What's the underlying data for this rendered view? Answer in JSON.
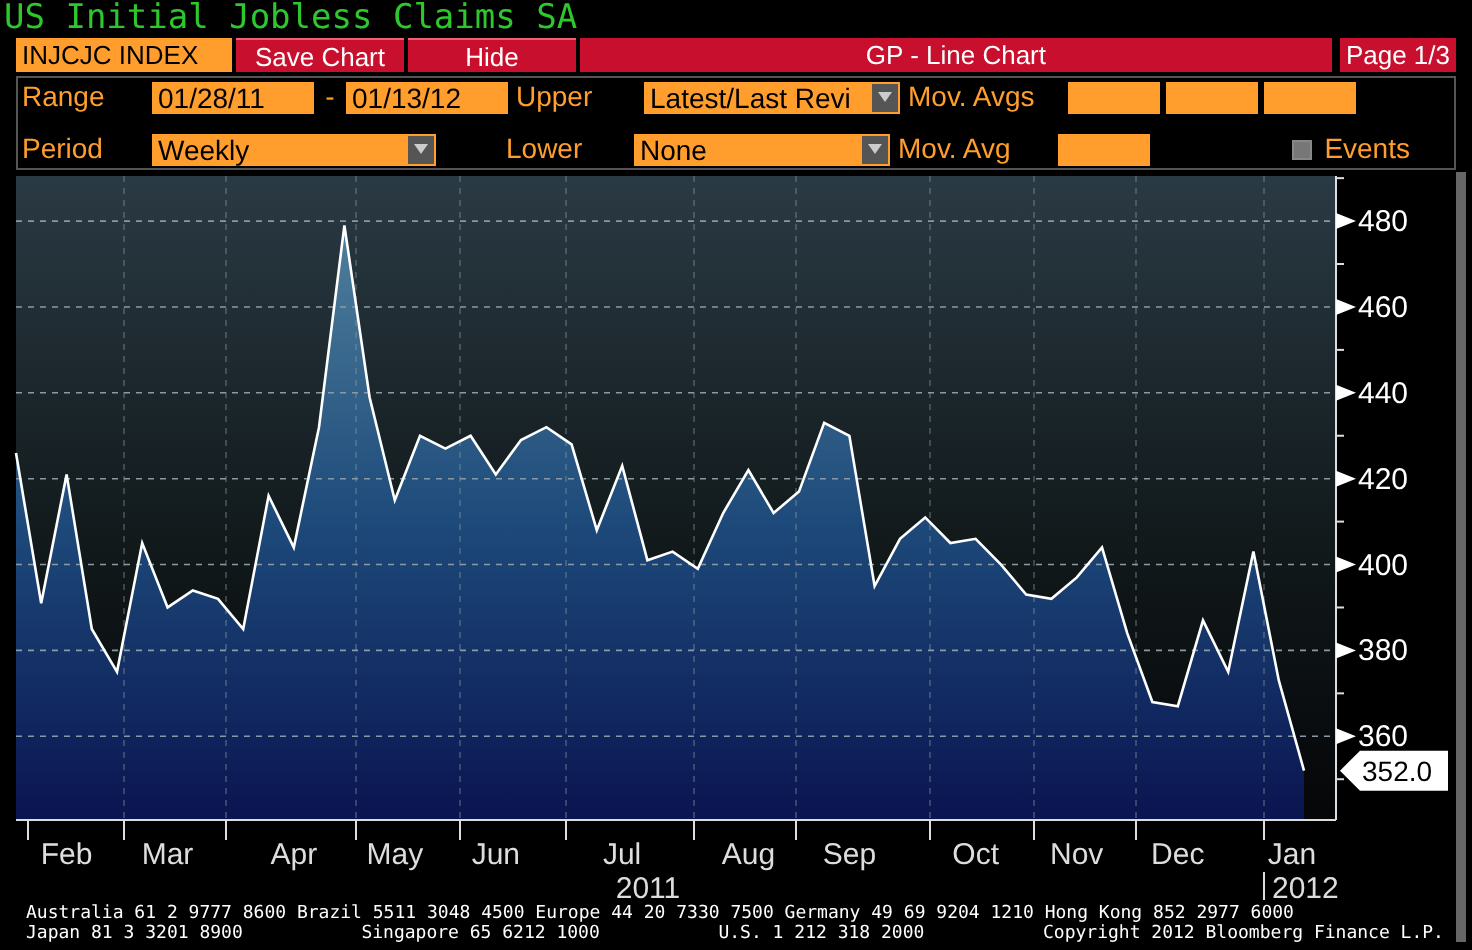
{
  "title": "US Initial Jobless Claims SA",
  "toolbar": {
    "ticker": "INJCJC INDEX",
    "buttons": [
      "Save Chart",
      "Hide"
    ],
    "chart_title": "GP - Line Chart",
    "page": "Page 1/3"
  },
  "controls": {
    "range_label": "Range",
    "range_start": "01/28/11",
    "range_separator": "-",
    "range_end": "01/13/12",
    "upper_label": "Upper",
    "upper_value": "Latest/Last Revi",
    "mov_avgs_label": "Mov. Avgs",
    "period_label": "Period",
    "period_value": "Weekly",
    "lower_label": "Lower",
    "lower_value": "None",
    "mov_avg_label": "Mov. Avg",
    "events": {
      "label": "Events",
      "checked": false
    }
  },
  "chart": {
    "last_value": "352.0",
    "year_labels": [
      "2011",
      "2012"
    ],
    "chart_data": {
      "type": "area",
      "grid": true,
      "ylim": [
        340.5,
        490.5
      ],
      "yticks": [
        360,
        380,
        400,
        420,
        440,
        460,
        480
      ],
      "categories": [
        null,
        null,
        "Feb",
        null,
        null,
        null,
        "Mar",
        null,
        null,
        null,
        null,
        "Apr",
        null,
        null,
        null,
        "May",
        null,
        null,
        null,
        "Jun",
        null,
        null,
        null,
        null,
        "Jul",
        null,
        null,
        null,
        null,
        "Aug",
        null,
        null,
        null,
        "Sep",
        null,
        null,
        null,
        null,
        "Oct",
        null,
        null,
        null,
        "Nov",
        null,
        null,
        null,
        "Dec",
        null,
        null,
        null,
        null,
        "Jan"
      ],
      "series": [
        {
          "color": "#ffffff",
          "values": [
            426,
            391,
            421,
            385,
            375,
            405,
            390,
            394,
            392,
            385,
            416,
            404,
            432,
            479,
            439,
            415,
            430,
            427,
            430,
            421,
            429,
            432,
            428,
            408,
            423,
            401,
            403,
            399,
            412,
            422,
            412,
            417,
            433,
            430,
            395,
            406,
            411,
            405,
            406,
            400,
            393,
            392,
            397,
            404,
            384,
            368,
            367,
            387,
            375,
            403,
            373,
            352
          ]
        }
      ]
    }
  },
  "footer": [
    [
      "Australia 61 2 9777 8600 Brazil 5511 3048 4500 Europe 44 20 7330 7500 Germany 49 69 9204 1210 Hong Kong 852 2977 6000"
    ],
    [
      "Japan 81 3 3201 8900",
      "Singapore 65 6212 1000",
      "U.S. 1 212 318 2000",
      "Copyright 2012 Bloomberg Finance L.P."
    ]
  ]
}
